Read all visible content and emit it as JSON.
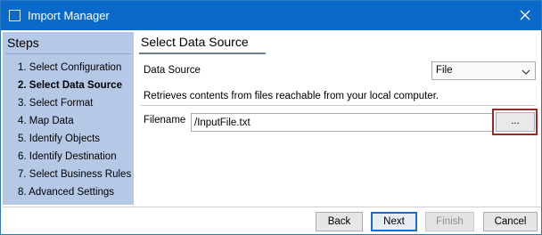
{
  "window": {
    "title": "Import Manager",
    "icons": {
      "app": "window-icon",
      "close": "close-icon"
    }
  },
  "steps": {
    "header": "Steps",
    "current_index": 1,
    "items": [
      "1. Select Configuration",
      "2. Select Data Source",
      "3. Select Format",
      "4. Map Data",
      "5. Identify Objects",
      "6. Identify Destination",
      "7. Select Business Rules",
      "8. Advanced Settings"
    ]
  },
  "main": {
    "section_title": "Select Data Source",
    "data_source_label": "Data Source",
    "data_source_value": "File",
    "description": "Retrieves contents from files reachable from your local computer.",
    "filename_label": "Filename",
    "filename_value": "/InputFile.txt",
    "browse_label": "..."
  },
  "footer": {
    "back_label": "Back",
    "next_label": "Next",
    "finish_label": "Finish",
    "cancel_label": "Cancel"
  },
  "colors": {
    "titlebar": "#0b6ac9",
    "steps_panel": "#b5c9e6",
    "highlight_border": "#9c2626",
    "primary_button_border": "#1a6dd0"
  }
}
